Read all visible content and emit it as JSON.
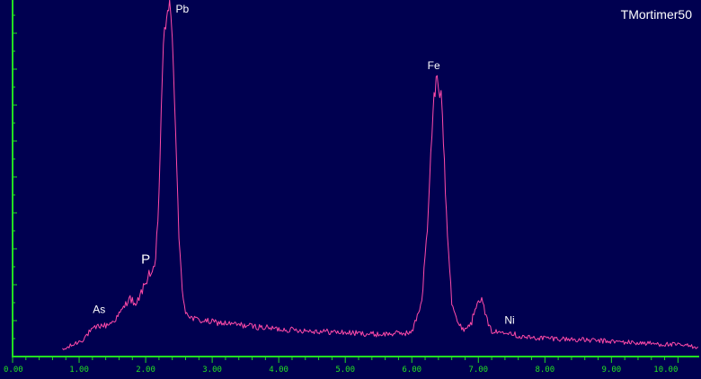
{
  "chart_data": {
    "type": "line",
    "title": "",
    "xlabel": "",
    "ylabel": "",
    "watermark": "TMortimer50",
    "xlim": [
      0,
      10.3
    ],
    "ylim": [
      0,
      100
    ],
    "x_ticks": [
      "0.00",
      "1.00",
      "2.00",
      "3.00",
      "4.00",
      "5.00",
      "6.00",
      "7.00",
      "8.00",
      "9.00",
      "10.00"
    ],
    "grid": false,
    "colors": {
      "background": "#000050",
      "axis": "#22e022",
      "line": "#ff4aa8",
      "labels": "#ffffff"
    },
    "series": [
      {
        "x": [
          0.75,
          0.85,
          0.95,
          1.05,
          1.15,
          1.22,
          1.3,
          1.4,
          1.5,
          1.6,
          1.7,
          1.75,
          1.8,
          1.85,
          1.9,
          1.95,
          2.0,
          2.05,
          2.1,
          2.15,
          2.2,
          2.25,
          2.3,
          2.33,
          2.36,
          2.4,
          2.45,
          2.5,
          2.55,
          2.6,
          2.7,
          2.8,
          3.0,
          3.5,
          4.0,
          4.5,
          5.0,
          5.5,
          6.0,
          6.15,
          6.25,
          6.32,
          6.38,
          6.42,
          6.46,
          6.52,
          6.6,
          6.7,
          6.8,
          6.9,
          6.95,
          7.0,
          7.05,
          7.1,
          7.15,
          7.2,
          7.3,
          7.4,
          7.5,
          7.6,
          7.8,
          8.0,
          8.5,
          9.0,
          9.5,
          10.0,
          10.3
        ],
        "values": [
          1,
          2,
          3,
          4,
          6,
          7,
          8,
          8,
          9,
          11,
          14,
          16,
          15,
          13,
          16,
          18,
          20,
          23,
          22,
          26,
          45,
          80,
          93,
          99,
          97,
          88,
          65,
          32,
          18,
          12,
          10,
          9.5,
          9,
          8,
          7,
          6.5,
          6,
          5.5,
          6,
          15,
          40,
          70,
          78,
          75,
          68,
          40,
          15,
          8,
          7,
          9,
          13,
          16,
          15,
          12,
          8,
          6.5,
          6,
          6.5,
          6,
          5,
          4.5,
          4.5,
          4,
          3.5,
          3,
          2.5,
          2
        ]
      }
    ],
    "annotations": [
      {
        "label": "As",
        "x": 1.3,
        "y": 11.5,
        "size": "small"
      },
      {
        "label": "P",
        "x": 2.0,
        "y": 25.5,
        "size": "large"
      },
      {
        "label": "Pb",
        "x": 2.55,
        "y": 96.5,
        "size": "small"
      },
      {
        "label": "Fe",
        "x": 6.33,
        "y": 80.5,
        "size": "small"
      },
      {
        "label": "Ni",
        "x": 7.47,
        "y": 8.5,
        "size": "small"
      }
    ]
  }
}
